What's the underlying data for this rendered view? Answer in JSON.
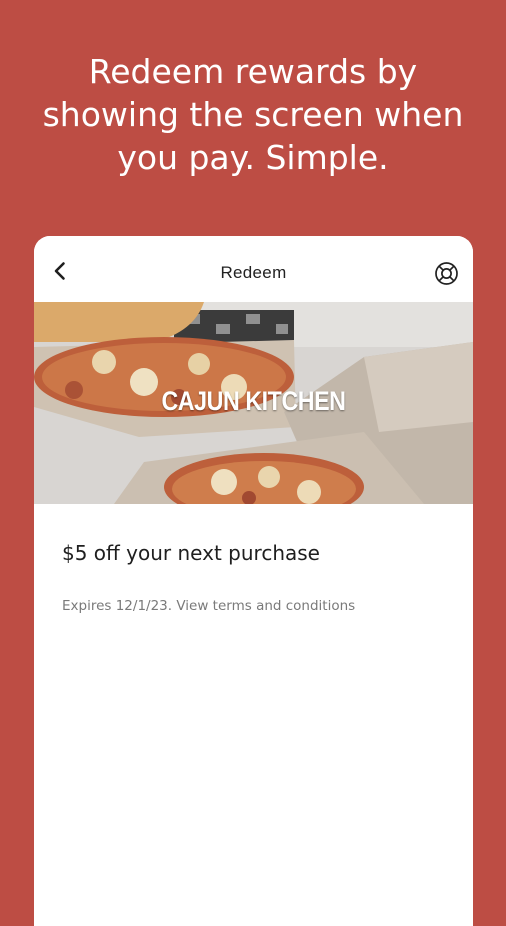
{
  "promo": {
    "headline_lines": [
      "Redeem rewards by",
      "showing the screen when",
      "you pay. Simple."
    ]
  },
  "screen": {
    "title": "Redeem",
    "back_icon": "chevron-left-icon",
    "help_icon": "lifebuoy-icon"
  },
  "hero": {
    "brand": "CAJUN KITCHEN"
  },
  "offer": {
    "title": "$5 off your next purchase",
    "meta": "Expires 12/1/23. View terms and conditions"
  },
  "colors": {
    "background": "#bd4d44",
    "card": "#ffffff",
    "text_primary": "#1f1f1f",
    "text_secondary": "#7a7a7a"
  }
}
